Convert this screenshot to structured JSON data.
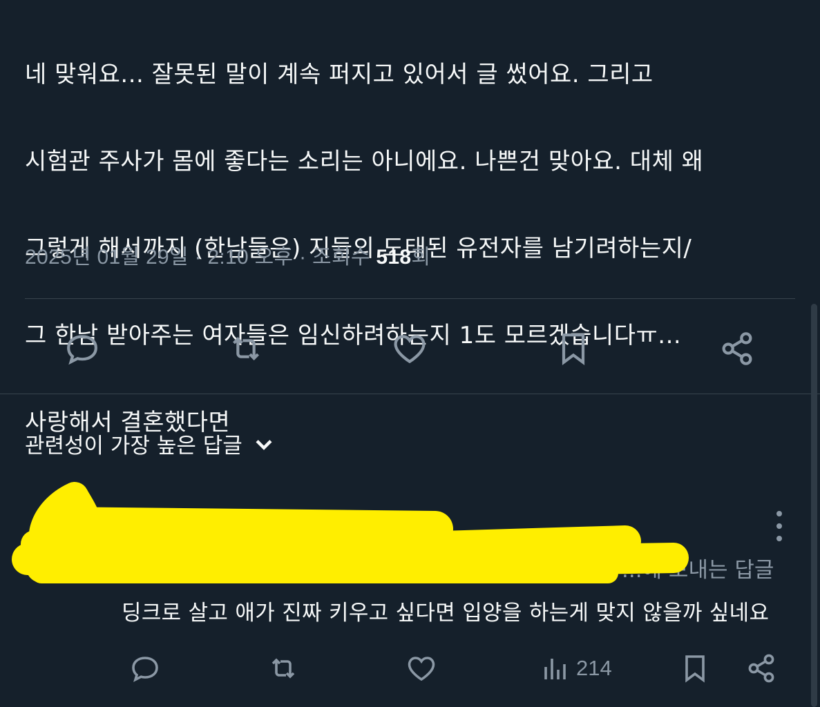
{
  "tweet": {
    "text_lines": [
      "네 맞워요... 잘못된 말이 계속 퍼지고 있어서 글 썼어요. 그리고",
      "시험관 주사가 몸에 좋다는 소리는 아니에요. 나쁜건 맞아요. 대체 왜",
      "그렇게 해서까지 (한남들은) 지들의 도태된 유전자를 남기려하는지/",
      "그 한남 받아주는 여자들은 임신하려하는지 1도 모르겠습니다ㅠ...",
      "사랑해서 결혼했다면"
    ],
    "date": "2025년 01월 29일",
    "time": "2:10 오후",
    "views_label": "조회수",
    "views_count": "518",
    "views_suffix": "회"
  },
  "icons": {
    "reply": "reply-icon",
    "retweet": "retweet-icon",
    "like": "heart-icon",
    "bookmark": "bookmark-icon",
    "share": "share-icon",
    "chevron": "chevron-down-icon",
    "more": "more-vertical-icon",
    "views": "views-chart-icon"
  },
  "replies_section": {
    "sort_label": "관련성이 가장 높은 답글"
  },
  "reply": {
    "context_text": "...에 보내는 답글",
    "text": "딩크로 살고 애가 진짜 키우고 싶다면 입양을 하는게 맞지 않을까 싶네요",
    "views": "214"
  },
  "colors": {
    "background": "#15202b",
    "text": "#f7f9f9",
    "muted": "#8b98a5",
    "divider": "#38444d",
    "censor_marker": "#ffee00"
  }
}
